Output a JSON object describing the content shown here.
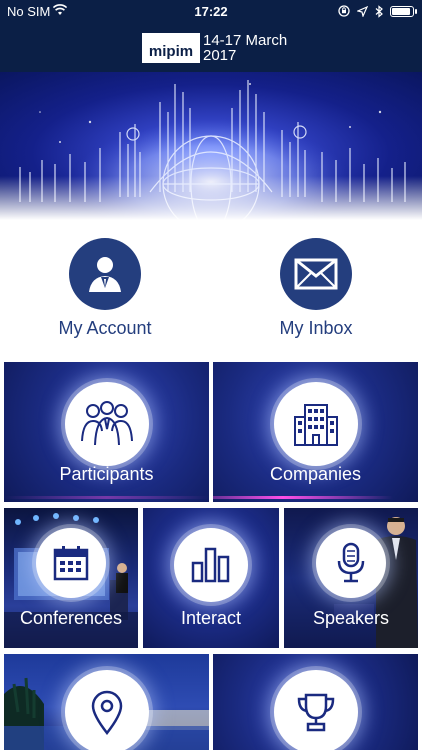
{
  "status_bar": {
    "carrier": "No SIM",
    "time": "17:22",
    "battery_level": 0.95
  },
  "header": {
    "logo_text": "mipim",
    "dates_line1": "14-17 March",
    "dates_line2": "2017"
  },
  "quick_actions": {
    "account": {
      "label": "My Account",
      "icon": "user-avatar-icon"
    },
    "inbox": {
      "label": "My Inbox",
      "icon": "envelope-icon"
    }
  },
  "tiles": {
    "participants": {
      "label": "Participants",
      "icon": "people-group-icon"
    },
    "companies": {
      "label": "Companies",
      "icon": "building-icon"
    },
    "conferences": {
      "label": "Conferences",
      "icon": "calendar-icon"
    },
    "interact": {
      "label": "Interact",
      "icon": "bar-chart-icon"
    },
    "speakers": {
      "label": "Speakers",
      "icon": "microphone-icon"
    },
    "map": {
      "label": "",
      "icon": "map-pin-icon"
    },
    "awards": {
      "label": "",
      "icon": "trophy-icon"
    }
  },
  "colors": {
    "header_bg": "#0b1f46",
    "accent": "#243e7e",
    "tile_bg": "#16236b",
    "glow": "#ff4fe6"
  }
}
